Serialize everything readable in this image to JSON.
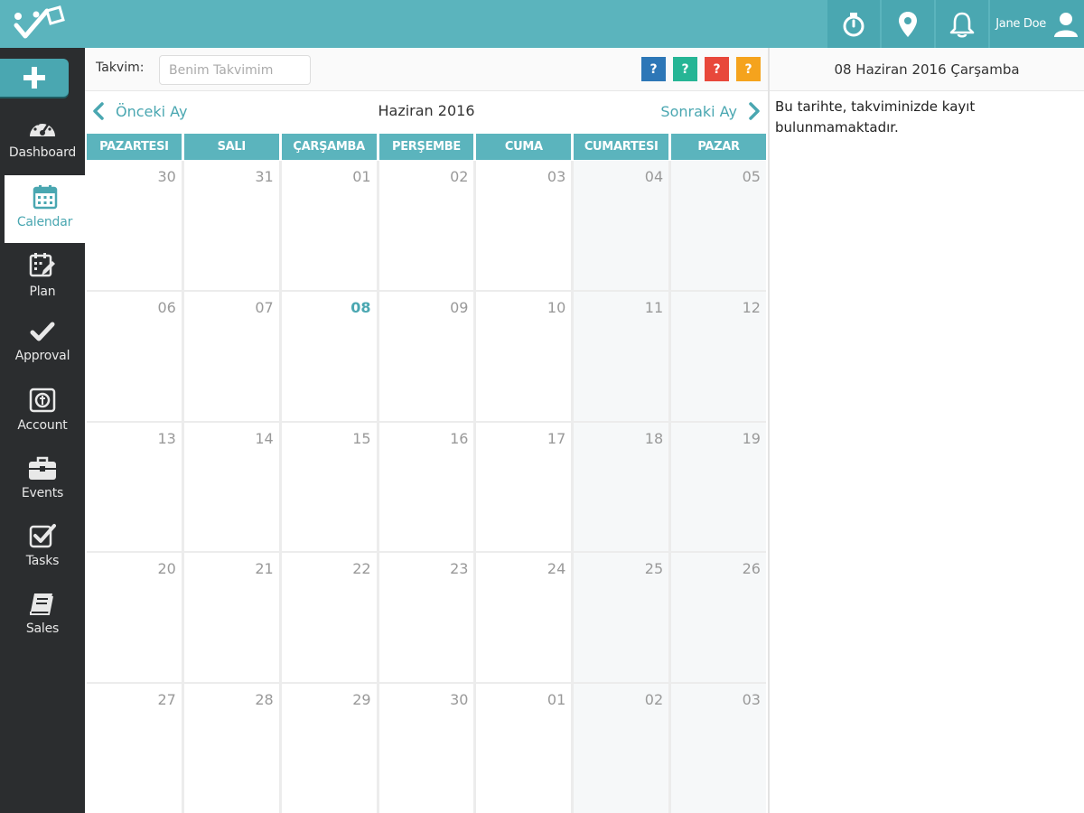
{
  "header": {
    "user_name": "Jane Doe",
    "actions": [
      {
        "icon": "stopwatch-icon"
      },
      {
        "icon": "map-pin-icon"
      },
      {
        "icon": "bell-icon"
      }
    ],
    "colors": {
      "bar": "#5bb4bd",
      "button": "#4aa7b1"
    }
  },
  "sidebar": {
    "add_icon": "plus-icon",
    "items": [
      {
        "label": "Dashboard",
        "icon": "dashboard-icon",
        "active": false
      },
      {
        "label": "Calendar",
        "icon": "calendar-icon",
        "active": true
      },
      {
        "label": "Plan",
        "icon": "plan-icon",
        "active": false
      },
      {
        "label": "Approval",
        "icon": "checkmark-icon",
        "active": false
      },
      {
        "label": "Account",
        "icon": "account-icon",
        "active": false
      },
      {
        "label": "Events",
        "icon": "briefcase-icon",
        "active": false
      },
      {
        "label": "Tasks",
        "icon": "checkbox-icon",
        "active": false
      },
      {
        "label": "Sales",
        "icon": "book-icon",
        "active": false
      }
    ]
  },
  "filter": {
    "label": "Takvim:",
    "placeholder": "Benim Takvimim",
    "help_buttons": [
      {
        "label": "?",
        "color": "#2d77b7"
      },
      {
        "label": "?",
        "color": "#26b595"
      },
      {
        "label": "?",
        "color": "#e8483b"
      },
      {
        "label": "?",
        "color": "#f5a31d"
      }
    ]
  },
  "calendar": {
    "prev_label": "Önceki Ay",
    "next_label": "Sonraki Ay",
    "month_title": "Haziran 2016",
    "weekdays": [
      "PAZARTESI",
      "SALI",
      "ÇARŞAMBA",
      "PERŞEMBE",
      "CUMA",
      "CUMARTESI",
      "PAZAR"
    ],
    "weeks": [
      [
        "30",
        "31",
        "01",
        "02",
        "03",
        "04",
        "05"
      ],
      [
        "06",
        "07",
        "08",
        "09",
        "10",
        "11",
        "12"
      ],
      [
        "13",
        "14",
        "15",
        "16",
        "17",
        "18",
        "19"
      ],
      [
        "20",
        "21",
        "22",
        "23",
        "24",
        "25",
        "26"
      ],
      [
        "27",
        "28",
        "29",
        "30",
        "01",
        "02",
        "03"
      ]
    ],
    "today": "08"
  },
  "detail": {
    "date_title": "08 Haziran 2016 Çarşamba",
    "message": "Bu tarihte, takviminizde kayıt bulunmamaktadır."
  }
}
